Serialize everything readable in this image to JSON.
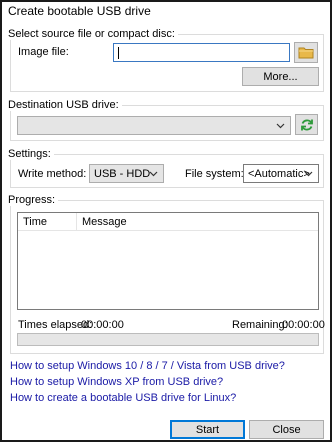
{
  "window": {
    "title": "Create bootable USB drive"
  },
  "source": {
    "legend": "Select source file or compact disc:",
    "image_label": "Image file:",
    "image_value": "",
    "more_label": "More..."
  },
  "destination": {
    "legend": "Destination USB drive:",
    "selected": ""
  },
  "settings": {
    "legend": "Settings:",
    "write_method_label": "Write method:",
    "write_method_value": "USB - HDD",
    "file_system_label": "File system:",
    "file_system_value": "<Automatic>"
  },
  "progress": {
    "legend": "Progress:",
    "col_time": "Time",
    "col_message": "Message",
    "elapsed_label": "Times elapsed:",
    "elapsed_value": "00:00:00",
    "remaining_label": "Remaining:",
    "remaining_value": "00:00:00",
    "percent": 0
  },
  "links": [
    "How to setup Windows 10 / 8 / 7 / Vista from USB drive?",
    "How to setup Windows XP from USB drive?",
    "How to create a bootable USB drive for Linux?"
  ],
  "buttons": {
    "start": "Start",
    "close": "Close"
  },
  "icons": {
    "open": "folder-icon",
    "refresh": "refresh-icon",
    "dropdown": "chevron-down-icon"
  },
  "colors": {
    "focus_border": "#3a78c2",
    "link": "#1a1aa6",
    "primary_border": "#0078d7",
    "folder": "#e8b84a",
    "refresh": "#2e9a3a"
  }
}
